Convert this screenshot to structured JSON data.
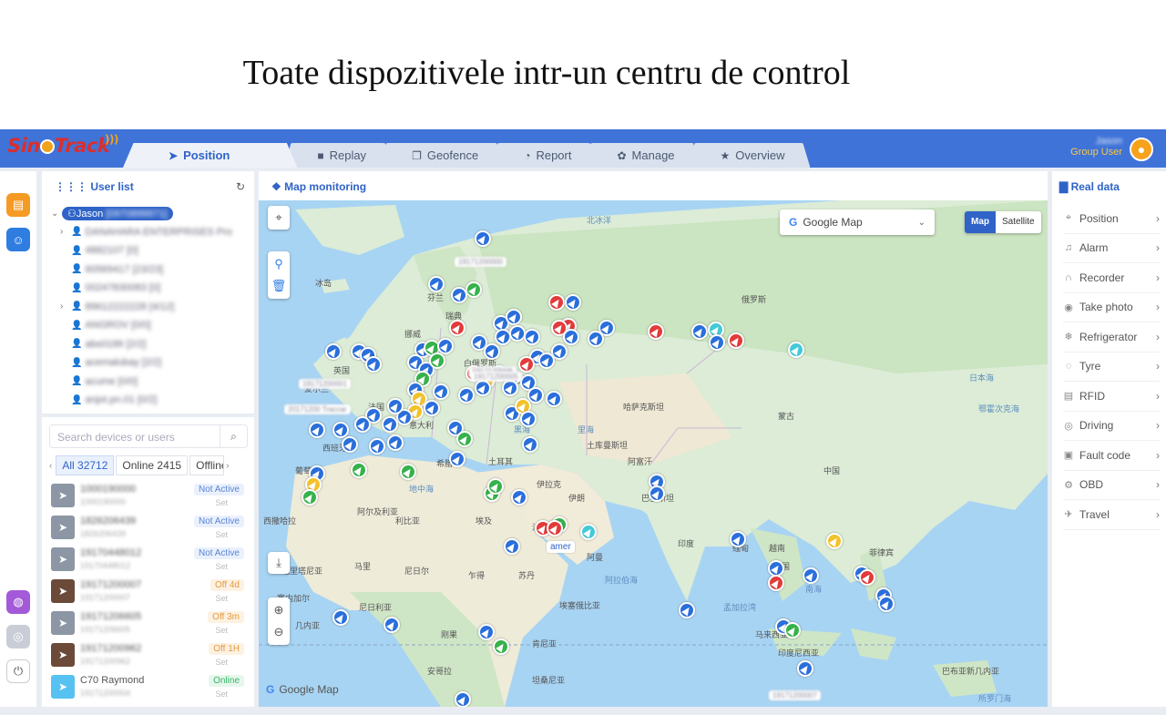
{
  "headline": "Toate dispozitivele intr-un centru de control",
  "app": {
    "logo": {
      "part1": "Sin",
      "part2": "Track"
    },
    "tabs": [
      {
        "label": "Position",
        "icon": "send-icon",
        "glyph": "◀"
      },
      {
        "label": "Replay",
        "icon": "video-icon",
        "glyph": "■"
      },
      {
        "label": "Geofence",
        "icon": "layers-icon",
        "glyph": "❐"
      },
      {
        "label": "Report",
        "icon": "pie-chart-icon",
        "glyph": "◔"
      },
      {
        "label": "Manage",
        "icon": "manage-icon",
        "glyph": "✿"
      },
      {
        "label": "Overview",
        "icon": "star-icon",
        "glyph": "★"
      }
    ],
    "user": {
      "name": "Jason",
      "role": "Group User"
    }
  },
  "user_list": {
    "title": "User list",
    "root": "Jason",
    "root_id": "[0970899971]",
    "nodes": [
      {
        "text": "DANAHARA ENTERPRISES Pro",
        "expandable": true
      },
      {
        "text": "4882107 [0]",
        "expandable": false
      },
      {
        "text": "60569417 [23/23]",
        "expandable": false
      },
      {
        "text": "00247830083 [0]",
        "expandable": false
      },
      {
        "text": "89612222228 [4/12]",
        "expandable": true
      },
      {
        "text": "ANGROV [0/0]",
        "expandable": false
      },
      {
        "text": "abs0186 [2/2]",
        "expandable": false
      },
      {
        "text": "acemalubay [2/2]",
        "expandable": false
      },
      {
        "text": "acume [0/0]",
        "expandable": false
      },
      {
        "text": "anjot.pn.01 [0/2]",
        "expandable": false
      }
    ]
  },
  "devices": {
    "search_placeholder": "Search devices or users",
    "filters": [
      "All 32712",
      "Online 2415",
      "Offline 6"
    ],
    "rows": [
      {
        "name": "1000190000",
        "sub": "1000190000",
        "status": "Not Active",
        "kind": "nact",
        "img": "gray",
        "set": "Set"
      },
      {
        "name": "1826206439",
        "sub": "1826206439",
        "status": "Not Active",
        "kind": "nact",
        "img": "gray",
        "set": "Set"
      },
      {
        "name": "19170448012",
        "sub": "19170448012",
        "status": "Not Active",
        "kind": "nact",
        "img": "gray",
        "set": "Set"
      },
      {
        "name": "19171200007",
        "sub": "19171200007",
        "status": "Off 4d",
        "kind": "off",
        "img": "car",
        "set": "Set"
      },
      {
        "name": "19171206605",
        "sub": "19171206605",
        "status": "Off 3m",
        "kind": "off",
        "img": "gray",
        "set": "Set"
      },
      {
        "name": "19171200962",
        "sub": "19171200962",
        "status": "Off 1H",
        "kind": "off",
        "img": "car",
        "set": "Set"
      },
      {
        "name": "C70 Raymond",
        "sub": "19171200004",
        "status": "Online",
        "kind": "online",
        "img": "on",
        "set": "Set"
      }
    ]
  },
  "map": {
    "title": "Map monitoring",
    "provider": "Google Map",
    "types": [
      "Map",
      "Satellite"
    ],
    "brand": "Google Map",
    "labels": [
      "冰岛",
      "芬兰",
      "挪威",
      "瑞典",
      "俄罗斯",
      "白俄罗斯",
      "乌克兰",
      "英国",
      "爱尔兰",
      "法国",
      "西班牙",
      "葡萄牙",
      "意大利",
      "希腊",
      "土耳其",
      "伊拉克",
      "伊朗",
      "沙特",
      "阿曼",
      "阿尔及利亚",
      "利比亚",
      "埃及",
      "马里",
      "尼日尔",
      "乍得",
      "苏丹",
      "尼日利亚",
      "埃塞俄比亚",
      "肯尼亚",
      "刚果",
      "坦桑尼亚",
      "安哥拉",
      "哈萨克斯坦",
      "蒙古",
      "中国",
      "印度",
      "巴基斯坦",
      "阿富汗",
      "土库曼斯坦",
      "缅甸",
      "泰国",
      "越南",
      "菲律宾",
      "印度尼西亚",
      "马来西亚",
      "日本海",
      "鄂霍次克海",
      "孟加拉湾",
      "阿拉伯海",
      "南海",
      "地中海",
      "黑海",
      "里海",
      "北冰洋",
      "西撒哈拉",
      "毛里塔尼亚",
      "塞内加尔",
      "几内亚",
      "巴布亚新几内亚",
      "所罗门海"
    ],
    "tags": [
      "19171200000",
      "19171200001",
      "1917120008",
      "20171200 Traccar",
      "amer",
      "19171200005",
      "19171200007"
    ]
  },
  "real_data": {
    "title": "Real data",
    "items": [
      {
        "label": "Position",
        "icon": "location-pin-icon",
        "glyph": "⌖"
      },
      {
        "label": "Alarm",
        "icon": "bell-icon",
        "glyph": "♫"
      },
      {
        "label": "Recorder",
        "icon": "headphones-icon",
        "glyph": "∩"
      },
      {
        "label": "Take photo",
        "icon": "camera-icon",
        "glyph": "◉"
      },
      {
        "label": "Refrigerator",
        "icon": "snowflake-icon",
        "glyph": "❄"
      },
      {
        "label": "Tyre",
        "icon": "tyre-icon",
        "glyph": "◌"
      },
      {
        "label": "RFID",
        "icon": "rfid-icon",
        "glyph": "▤"
      },
      {
        "label": "Driving",
        "icon": "steering-icon",
        "glyph": "◎"
      },
      {
        "label": "Fault code",
        "icon": "engine-icon",
        "glyph": "▣"
      },
      {
        "label": "OBD",
        "icon": "obd-icon",
        "glyph": "⚙"
      },
      {
        "label": "Travel",
        "icon": "travel-icon",
        "glyph": "✈"
      }
    ]
  }
}
